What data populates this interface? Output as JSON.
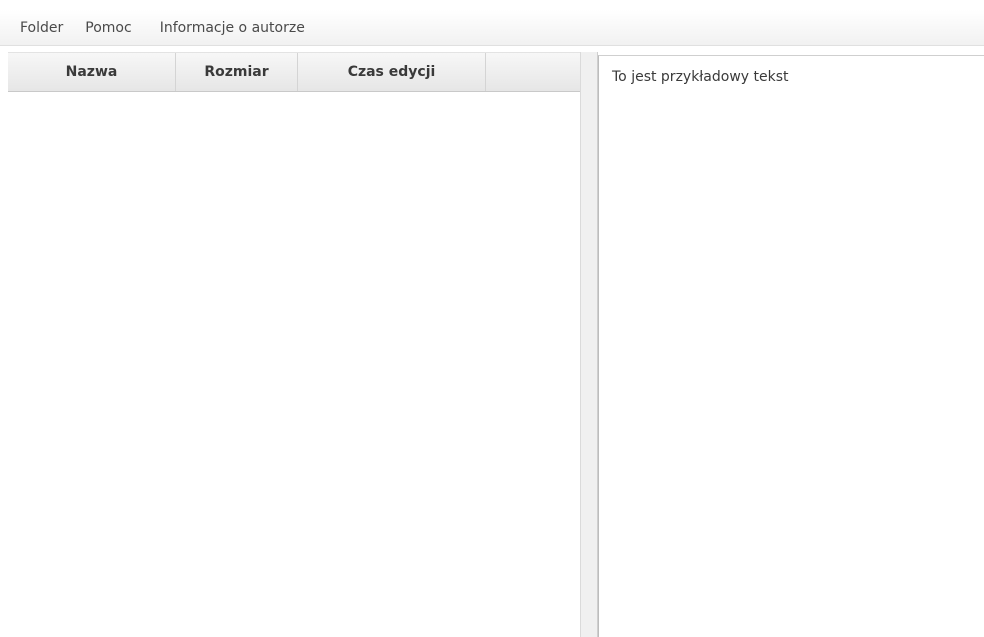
{
  "menubar": {
    "items": [
      {
        "label": "Folder"
      },
      {
        "label": "Pomoc"
      },
      {
        "label": "Informacje o autorze"
      }
    ]
  },
  "file_table": {
    "columns": [
      {
        "label": "Nazwa"
      },
      {
        "label": "Rozmiar"
      },
      {
        "label": "Czas edycji"
      }
    ],
    "rows": []
  },
  "editor": {
    "text": "To jest przykładowy tekst"
  }
}
